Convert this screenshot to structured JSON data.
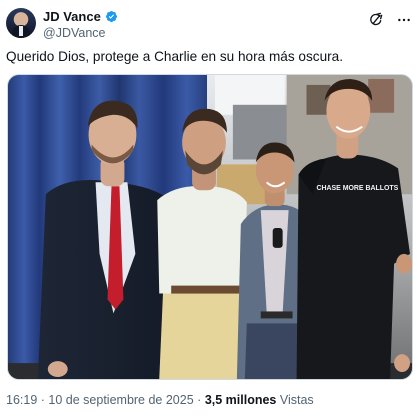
{
  "author": {
    "display_name": "JD Vance",
    "handle": "@JDVance",
    "avatar_icon": "profile-photo",
    "verified_icon": "verified-badge-icon",
    "verified_color": "#1d9bf0"
  },
  "actions": {
    "grok_icon": "grok-icon",
    "more_icon": "more-options-icon"
  },
  "tweet": {
    "text": "Querido Dios, protege a Charlie en su hora más oscura."
  },
  "media": {
    "shirt_text": "CHASE MORE BALLOTS"
  },
  "meta": {
    "time": "16:19",
    "separator": "·",
    "date": "10 de septiembre de 2025",
    "views_count": "3,5 millones",
    "views_label": "Vistas"
  }
}
